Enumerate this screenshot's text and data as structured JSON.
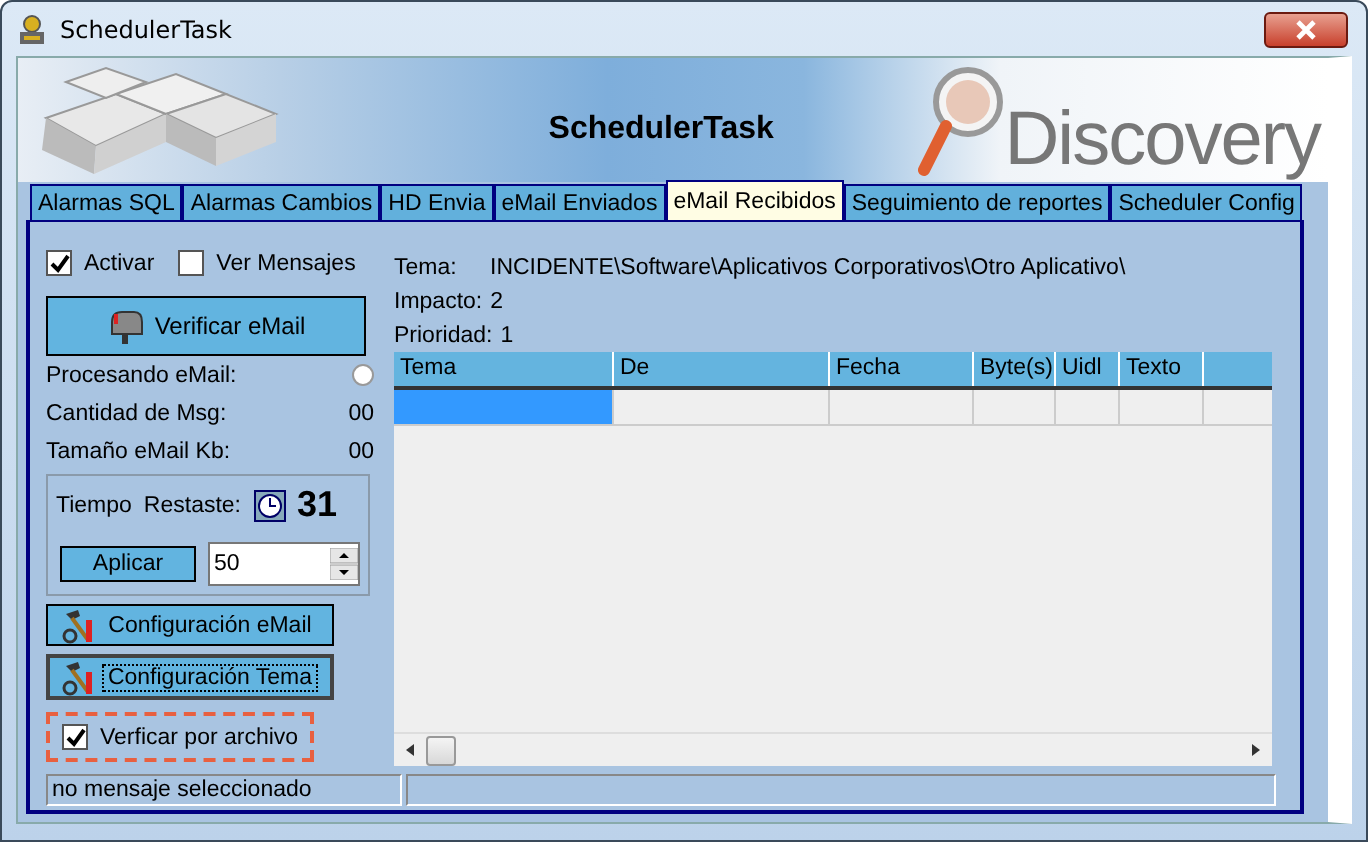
{
  "window": {
    "title": "SchedulerTask"
  },
  "banner": {
    "title": "SchedulerTask",
    "logo": "Discovery"
  },
  "tabs": [
    {
      "label": "Alarmas SQL",
      "selected": false
    },
    {
      "label": "Alarmas Cambios",
      "selected": false
    },
    {
      "label": "HD Envia",
      "selected": false
    },
    {
      "label": "eMail Enviados",
      "selected": false
    },
    {
      "label": "eMail Recibidos",
      "selected": true
    },
    {
      "label": "Seguimiento de reportes",
      "selected": false
    },
    {
      "label": "Scheduler Config",
      "selected": false
    }
  ],
  "options": [
    {
      "label": "Activar",
      "checked": true
    },
    {
      "label": "Ver Mensajes",
      "checked": false
    }
  ],
  "verify_button": "Verificar eMail",
  "processing": {
    "label": "Procesando eMail:",
    "selected": false
  },
  "stats": [
    {
      "label": "Cantidad  de Msg:",
      "value": "00"
    },
    {
      "label": "Tamaño eMail Kb:",
      "value": "00"
    }
  ],
  "timer": {
    "label": "Tiempo",
    "remaining_label": "Restaste:",
    "remaining": "31",
    "apply_button": "Aplicar",
    "interval": "50"
  },
  "config_buttons": [
    {
      "label": "Configuración eMail",
      "focused": false
    },
    {
      "label": "Configuración Tema",
      "focused": true
    }
  ],
  "file_check": {
    "label": "Verficar por archivo",
    "checked": true,
    "highlighted": true
  },
  "details": [
    {
      "label": "Tema:",
      "value": "INCIDENTE\\Software\\Aplicativos Corporativos\\Otro Aplicativo\\"
    },
    {
      "label": "Impacto:",
      "value": "2"
    },
    {
      "label": "Prioridad:",
      "value": "1"
    }
  ],
  "table": {
    "columns": [
      "Tema",
      "De",
      "Fecha",
      "Byte(s)",
      "Uidl",
      "Texto"
    ],
    "rows": [
      {
        "selected": true
      }
    ]
  },
  "status_bar": [
    "no mensaje seleccionado"
  ]
}
